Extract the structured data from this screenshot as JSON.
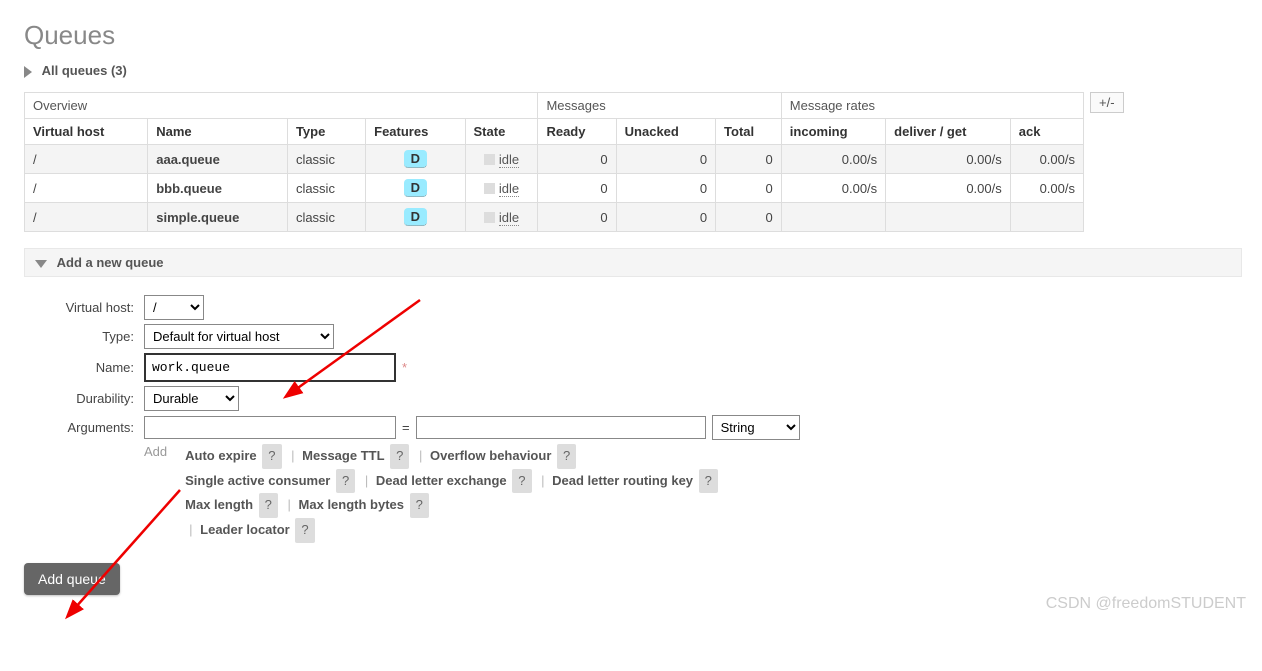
{
  "page": {
    "title": "Queues",
    "all_queues_label": "All queues (3)",
    "plusminus": "+/-",
    "add_section_title": "Add a new queue"
  },
  "table": {
    "group_headers": [
      "Overview",
      "Messages",
      "Message rates"
    ],
    "cols": [
      "Virtual host",
      "Name",
      "Type",
      "Features",
      "State",
      "Ready",
      "Unacked",
      "Total",
      "incoming",
      "deliver / get",
      "ack"
    ],
    "feature_badge": "D",
    "state_label": "idle",
    "rows": [
      {
        "vhost": "/",
        "name": "aaa.queue",
        "type": "classic",
        "ready": "0",
        "unacked": "0",
        "total": "0",
        "incoming": "0.00/s",
        "deliver": "0.00/s",
        "ack": "0.00/s"
      },
      {
        "vhost": "/",
        "name": "bbb.queue",
        "type": "classic",
        "ready": "0",
        "unacked": "0",
        "total": "0",
        "incoming": "0.00/s",
        "deliver": "0.00/s",
        "ack": "0.00/s"
      },
      {
        "vhost": "/",
        "name": "simple.queue",
        "type": "classic",
        "ready": "0",
        "unacked": "0",
        "total": "0",
        "incoming": "",
        "deliver": "",
        "ack": ""
      }
    ]
  },
  "form": {
    "labels": {
      "vhost": "Virtual host:",
      "type": "Type:",
      "name": "Name:",
      "durability": "Durability:",
      "arguments": "Arguments:"
    },
    "vhost_value": "/",
    "type_value": "Default for virtual host",
    "name_value": "work.queue",
    "durability_value": "Durable",
    "arg_key": "",
    "arg_eq": "=",
    "arg_val": "",
    "arg_type_value": "String",
    "add_arg_label": "Add",
    "hints": [
      "Auto expire",
      "Message TTL",
      "Overflow behaviour",
      "Single active consumer",
      "Dead letter exchange",
      "Dead letter routing key",
      "Max length",
      "Max length bytes",
      "Leader locator"
    ],
    "q": "?",
    "sep": "|",
    "required_mark": "*",
    "submit_label": "Add queue"
  },
  "watermark": "CSDN @freedomSTUDENT"
}
